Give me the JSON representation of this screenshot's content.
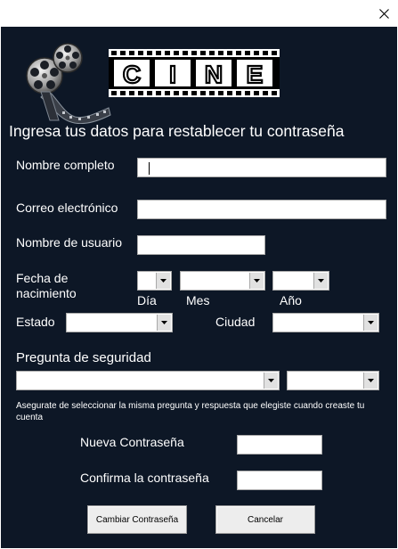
{
  "window": {
    "close_icon": "close-icon"
  },
  "logo": {
    "reel_icon": "film-reel-icon",
    "text": "CINE"
  },
  "form": {
    "heading": "Ingresa tus datos para restablecer tu contraseña",
    "full_name": {
      "label": "Nombre completo",
      "value": ""
    },
    "email": {
      "label": "Correo electrónico",
      "value": ""
    },
    "username": {
      "label": "Nombre de usuario",
      "value": ""
    },
    "birthdate": {
      "label": "Fecha de\nnacimiento",
      "day_label": "Día",
      "month_label": "Mes",
      "year_label": "Año",
      "day_value": "",
      "month_value": "",
      "year_value": ""
    },
    "state": {
      "label": "Estado",
      "value": ""
    },
    "city": {
      "label": "Ciudad",
      "value": ""
    },
    "security": {
      "label": "Pregunta de seguridad",
      "question_value": "",
      "answer_value": "",
      "hint": "Asegurate de seleccionar la misma pregunta y respuesta que elegiste cuando creaste tu cuenta"
    },
    "new_password": {
      "label": "Nueva Contraseña",
      "value": ""
    },
    "confirm_password": {
      "label": "Confirma la contraseña",
      "value": ""
    },
    "buttons": {
      "change": "Cambiar Contraseña",
      "cancel": "Cancelar"
    }
  },
  "colors": {
    "background": "#0d1726",
    "text": "#ffffff",
    "field": "#ffffff"
  }
}
